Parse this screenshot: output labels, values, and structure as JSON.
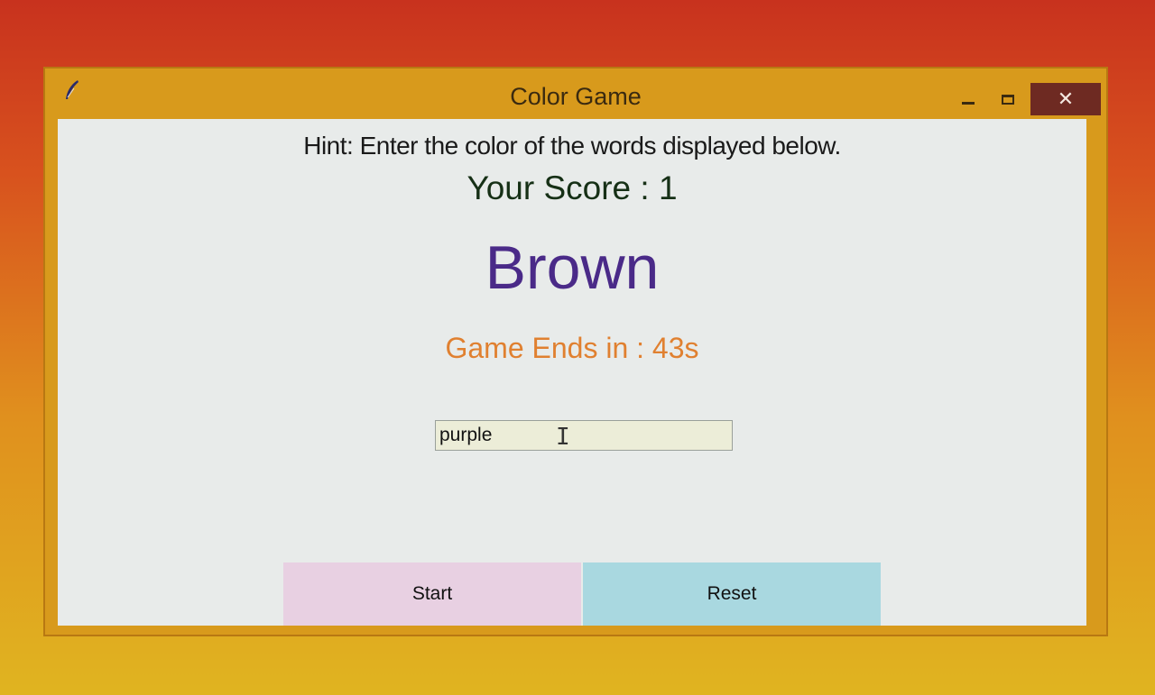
{
  "window": {
    "title": "Color Game",
    "app_icon": "feather-icon",
    "controls": [
      "minimize-icon",
      "maximize-icon",
      "close-icon"
    ],
    "close_symbol": "✕"
  },
  "game": {
    "hint": "Hint: Enter the color of the words displayed below.",
    "score": "Your Score : 1",
    "word": "Brown",
    "word_color": "#4a2a88",
    "timer": "Game Ends in : 43s",
    "timer_color": "#e08030",
    "input_value": "purple"
  },
  "buttons": {
    "start_label": "Start",
    "start_color": "#e8d0e2",
    "reset_label": "Reset",
    "reset_color": "#a9d8e0"
  }
}
